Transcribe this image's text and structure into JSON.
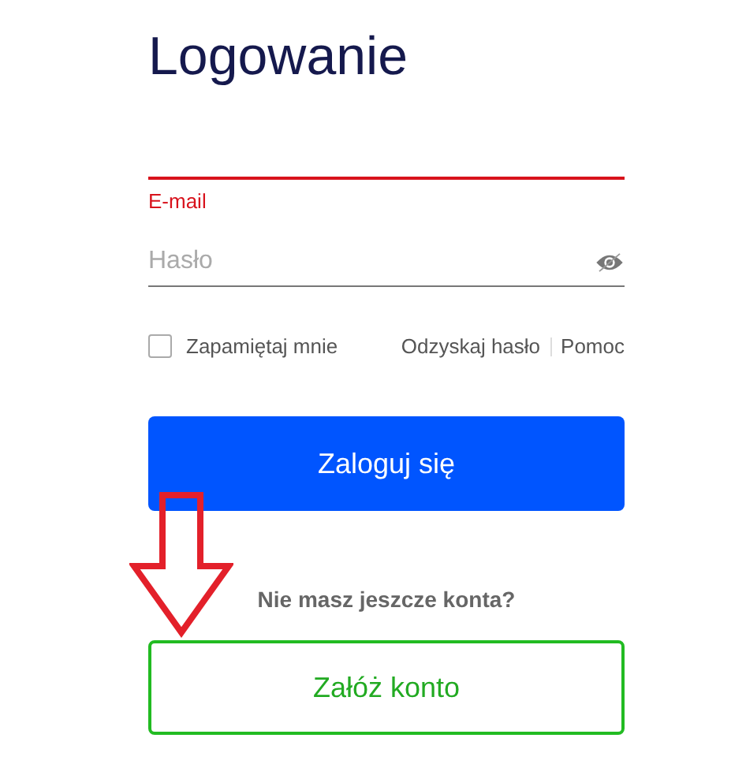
{
  "title": "Logowanie",
  "email": {
    "label": "E-mail",
    "invalid": true
  },
  "password": {
    "placeholder": "Hasło"
  },
  "remember": {
    "label": "Zapamiętaj mnie",
    "checked": false
  },
  "links": [
    "Odzyskaj hasło",
    "Pomoc"
  ],
  "login_button": "Zaloguj się",
  "signup_prompt": "Nie masz jeszcze konta?",
  "signup_button": "Załóż konto",
  "annotation": {
    "kind": "arrow"
  }
}
